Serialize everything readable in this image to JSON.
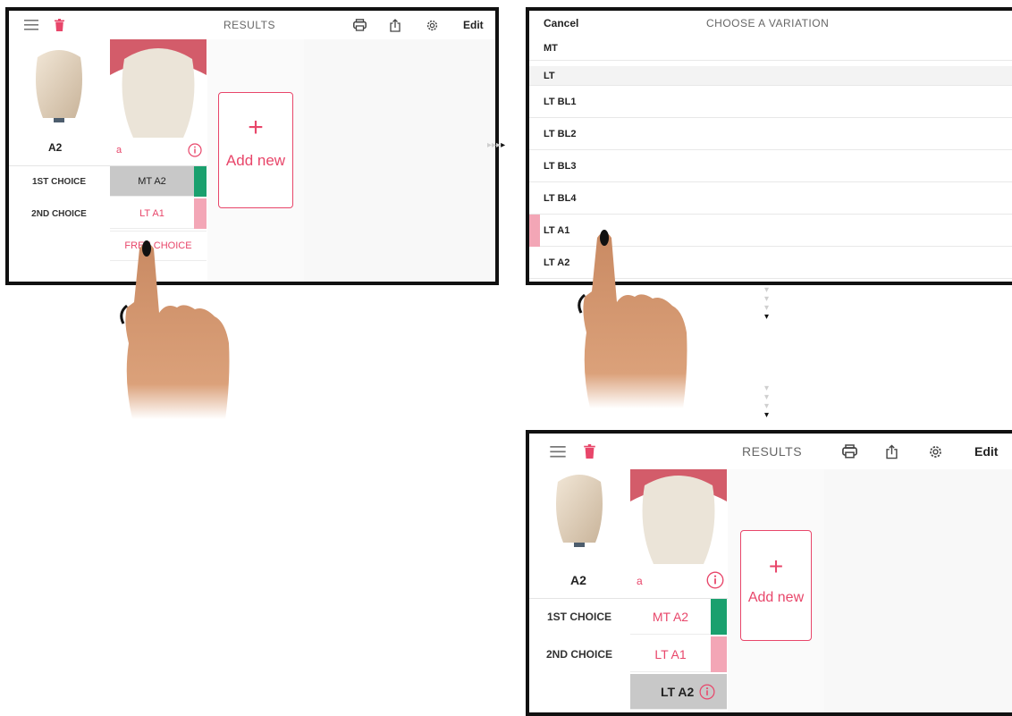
{
  "screen1": {
    "title": "RESULTS",
    "edit_label": "Edit",
    "shade_label": "A2",
    "card_label": "a",
    "row1_label": "1ST CHOICE",
    "row2_label": "2ND CHOICE",
    "choice1": "MT A2",
    "choice2": "LT A1",
    "choice3": "FREE CHOICE",
    "add_new": "Add new",
    "add_plus": "+"
  },
  "screen2": {
    "cancel_label": "Cancel",
    "title": "CHOOSE A VARIATION",
    "section1": "MT",
    "section2": "LT",
    "items": [
      "LT BL1",
      "LT BL2",
      "LT BL3",
      "LT BL4",
      "LT A1",
      "LT A2"
    ]
  },
  "screen3": {
    "title": "RESULTS",
    "edit_label": "Edit",
    "shade_label": "A2",
    "card_label": "a",
    "row1_label": "1ST CHOICE",
    "row2_label": "2ND CHOICE",
    "choice1": "MT A2",
    "choice2": "LT A1",
    "choice3": "LT A2",
    "add_new": "Add new",
    "add_plus": "+"
  },
  "colors": {
    "accent_red": "#e8466a",
    "green_bar": "#1aa06e",
    "pink_bar": "#f3a6b6",
    "selected_gray": "#c8c8c8",
    "border": "#111111"
  },
  "icons": [
    "menu-icon",
    "trash-icon",
    "print-icon",
    "share-icon",
    "gear-icon",
    "info-icon",
    "plus-icon",
    "arrow-icon"
  ]
}
